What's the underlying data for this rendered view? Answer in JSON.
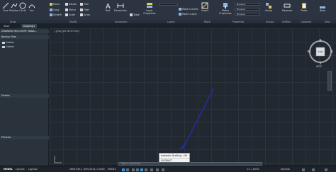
{
  "ribbon": {
    "draw": [
      {
        "label": "Line",
        "icon": "line-icon"
      },
      {
        "label": "Polyline",
        "icon": "polyline-icon"
      },
      {
        "label": "Circle",
        "icon": "circle-icon"
      },
      {
        "label": "Arc",
        "icon": "arc-icon"
      }
    ],
    "modify_small": [
      "Move",
      "Copy",
      "Stretch",
      "Rotate",
      "Mirror",
      "Scale",
      "Trim",
      "Fillet",
      "Array"
    ],
    "text_label": "Text",
    "dimension_label": "Dimension",
    "table_label": "Table",
    "layer_properties_label": "Layer Properties",
    "make_current_label": "Make Current",
    "match_layer_label": "Match Layer",
    "insert_label": "Insert",
    "match_properties_label": "Match Properties",
    "bylayer_values": [
      "ByLayer",
      "ByLayer",
      "ByLayer"
    ],
    "group_label": "Group",
    "measure_label": "Measure",
    "paste_label": "Paste",
    "base_label": "Base"
  },
  "panels": [
    "Draw",
    "Modify",
    "Annotation",
    "Layers",
    "Block",
    "Properties",
    "Groups",
    "Utilities",
    "Clipboard",
    "View"
  ],
  "tabs": [
    "Start",
    "Drawing1"
  ],
  "left": {
    "title": "DRAWING RECOVERY MANA...",
    "backup_header": "Backup Files",
    "files": [
      "Caddex",
      "Caddex"
    ],
    "details_header": "Details",
    "preview_header": "Preview"
  },
  "viewport_label": "[-][Top][2D Wireframe]",
  "compass": {
    "n": "N",
    "s": "S",
    "e": "E",
    "w": "W",
    "face": "TOP",
    "wcs": "WCS"
  },
  "tooltip": {
    "title": "Isometric Drafting - Off",
    "sub": "ISODRAFT"
  },
  "command_placeholder": "Type a command",
  "status": {
    "tabs": [
      "MODEL",
      "Layout1",
      "Layout2"
    ],
    "coords": "2609.2591, 1095.2524, 0.0000",
    "model_label": "MODEL",
    "scale": "1:1 / 100%",
    "units": "Decimal"
  },
  "colors": {
    "accent": "#1f2fa8",
    "grid": "#2b333d"
  }
}
